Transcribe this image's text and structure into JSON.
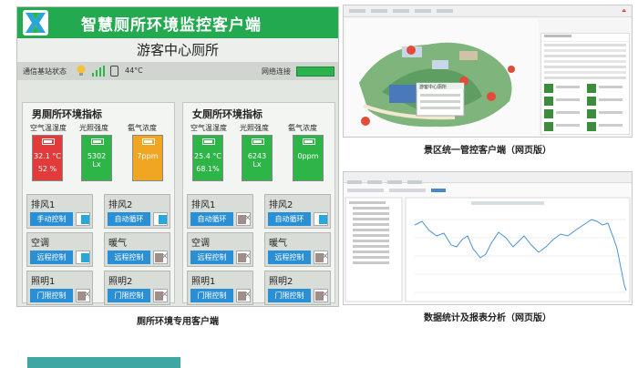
{
  "client": {
    "title": "智慧厕所环境监控客户端",
    "subtitle": "游客中心厕所",
    "status_label": "通信基站状态",
    "temperature": "44°C",
    "network_label": "网络连接",
    "male": {
      "title": "男厕所环境指标",
      "metric_labels": [
        "空气温湿度",
        "光照强度",
        "氨气浓度"
      ],
      "temp": "32.1 °C",
      "humidity": "52 %",
      "light": "5302 Lx",
      "ammonia": "7ppm",
      "controls": [
        {
          "name": "排风1",
          "button": "手动控制",
          "state": "on"
        },
        {
          "name": "排风2",
          "button": "自动循环",
          "state": "on"
        },
        {
          "name": "空调",
          "button": "远程控制",
          "state": "on"
        },
        {
          "name": "暖气",
          "button": "远程控制",
          "state": "off"
        },
        {
          "name": "照明1",
          "button": "门限控制",
          "state": "off"
        },
        {
          "name": "照明2",
          "button": "门限控制",
          "state": "off"
        }
      ]
    },
    "female": {
      "title": "女厕所环境指标",
      "metric_labels": [
        "空气温湿度",
        "光照强度",
        "氨气浓度"
      ],
      "temp": "25.4 °C",
      "humidity": "68.1%",
      "light": "6243 Lx",
      "ammonia": "0ppm",
      "controls": [
        {
          "name": "排风1",
          "button": "自动循环",
          "state": "off"
        },
        {
          "name": "排风2",
          "button": "自动循环",
          "state": "on"
        },
        {
          "name": "空调",
          "button": "远程控制",
          "state": "off"
        },
        {
          "name": "暖气",
          "button": "远程控制",
          "state": "off"
        },
        {
          "name": "照明1",
          "button": "门限控制",
          "state": "off"
        },
        {
          "name": "照明2",
          "button": "门限控制",
          "state": "off"
        }
      ]
    },
    "caption": "厕所环境专用客户端"
  },
  "map_web": {
    "caption": "景区统一管控客户端（网页版）",
    "popup_title": "游客中心厕所"
  },
  "chart_web": {
    "caption": "数据统计及报表分析（网页版）"
  },
  "colors": {
    "header_green": "#23a94f",
    "alert_red": "#e23b3b",
    "ok_green": "#2eb548",
    "warn_orange": "#f0a623",
    "button_blue": "#2a8fd4"
  }
}
